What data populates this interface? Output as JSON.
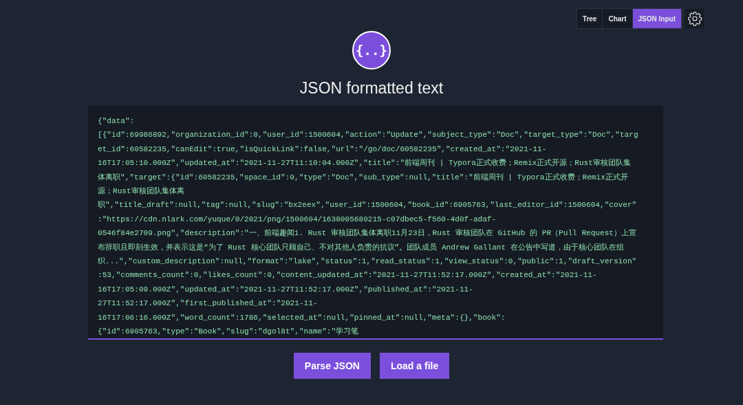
{
  "view_tabs": [
    {
      "label": "Tree",
      "selected": false
    },
    {
      "label": "Chart",
      "selected": false
    },
    {
      "label": "JSON Input",
      "selected": true
    }
  ],
  "logo": {
    "text": "{..}"
  },
  "heading": "JSON formatted text",
  "json_input": {
    "lines": [
      "{\"data\":",
      "[{\"id\":69986892,\"organization_id\":0,\"user_id\":1500604,\"action\":\"Update\",\"subject_type\":\"Doc\",\"target_type\":\"Doc\",\"targ",
      "et_id\":60582235,\"canEdit\":true,\"isQuickLink\":false,\"url\":\"/go/doc/60582235\",\"created_at\":\"2021-11-",
      "16T17:05:10.000Z\",\"updated_at\":\"2021-11-27T11:10:04.000Z\",\"title\":\"前端周刊 | Typora正式收费；Remix正式开源；Rust审核团队集",
      "体离职\",\"target\":{\"id\":60582235,\"space_id\":0,\"type\":\"Doc\",\"sub_type\":null,\"title\":\"前端周刊 | Typora正式收费；Remix正式开",
      "源；Rust审核团队集体离",
      "职\",\"title_draft\":null,\"tag\":null,\"slug\":\"bx2eex\",\"user_id\":1500604,\"book_id\":6905763,\"last_editor_id\":1500604,\"cover\"",
      ":\"https://cdn.nlark.com/yuque/0/2021/png/1500604/1638005680215-c07dbec5-f560-4d0f-adaf-",
      "0546f84e2709.png\",\"description\":\"一、前端趣闻1. Rust 审核团队集体离职11月23日，Rust 审核团队在 GitHub 的 PR（Pull Request）上宣",
      "布辞职且即刻生效，并表示这是“为了 Rust 核心团队只顾自己、不对其他人负责的抗议”。团队成员 Andrew Gallant 在公告中写道，由于核心团队在组",
      "织...\",\"custom_description\":null,\"format\":\"lake\",\"status\":1,\"read_status\":1,\"view_status\":0,\"public\":1,\"draft_version\"",
      ":53,\"comments_count\":0,\"likes_count\":0,\"content_updated_at\":\"2021-11-27T11:52:17.000Z\",\"created_at\":\"2021-11-",
      "16T17:05:09.000Z\",\"updated_at\":\"2021-11-27T11:52:17.000Z\",\"published_at\":\"2021-11-",
      "27T11:52:17.000Z\",\"first_published_at\":\"2021-11-",
      "16T17:06:16.000Z\",\"word_count\":1786,\"selected_at\":null,\"pinned_at\":null,\"meta\":{},\"book\":",
      "{\"id\":6905763,\"type\":\"Book\",\"slug\":\"dgol8t\",\"name\":\"学习笔"
    ]
  },
  "buttons": [
    {
      "label": "Parse JSON"
    },
    {
      "label": "Load a file"
    }
  ]
}
